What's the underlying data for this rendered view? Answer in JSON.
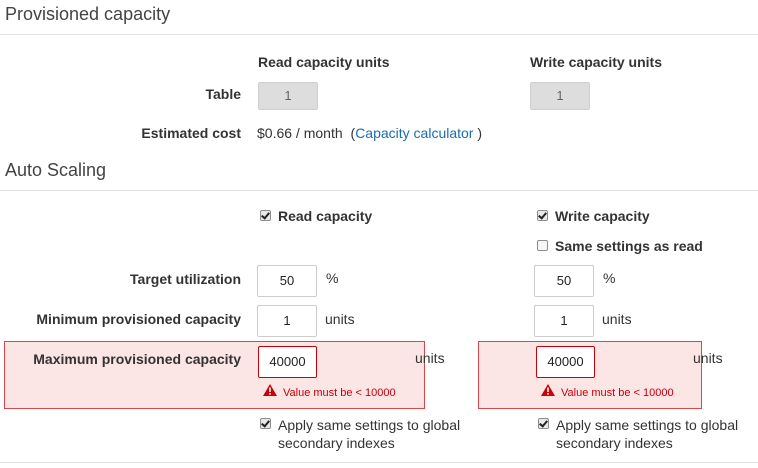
{
  "provisioned": {
    "section_title": "Provisioned capacity",
    "col_read": "Read capacity units",
    "col_write": "Write capacity units",
    "row_table_label": "Table",
    "read_units": "1",
    "write_units": "1",
    "estimated_cost_label": "Estimated cost",
    "estimated_cost_value": "$0.66 / month",
    "calc_open": "(",
    "calc_link": "Capacity calculator",
    "calc_close": ")"
  },
  "autoscaling": {
    "section_title": "Auto Scaling",
    "read_capacity_label": "Read capacity",
    "read_capacity_checked": true,
    "write_capacity_label": "Write capacity",
    "write_capacity_checked": true,
    "same_settings_label": "Same settings as read",
    "same_settings_checked": false,
    "target_label": "Target utilization",
    "target_read": "50",
    "target_write": "50",
    "percent": "%",
    "min_label": "Minimum provisioned capacity",
    "min_read": "1",
    "min_write": "1",
    "units": "units",
    "max_label": "Maximum provisioned capacity",
    "max_read": "40000",
    "max_write": "40000",
    "error_text": "Value must be < 10000",
    "apply_gsi_label_line1": "Apply same settings to global",
    "apply_gsi_label_line2": "secondary indexes",
    "apply_gsi_read_checked": true,
    "apply_gsi_write_checked": true
  },
  "colors": {
    "error_red": "#c7000a",
    "error_bg": "#fbe5e5",
    "link_blue": "#1a6db0"
  }
}
